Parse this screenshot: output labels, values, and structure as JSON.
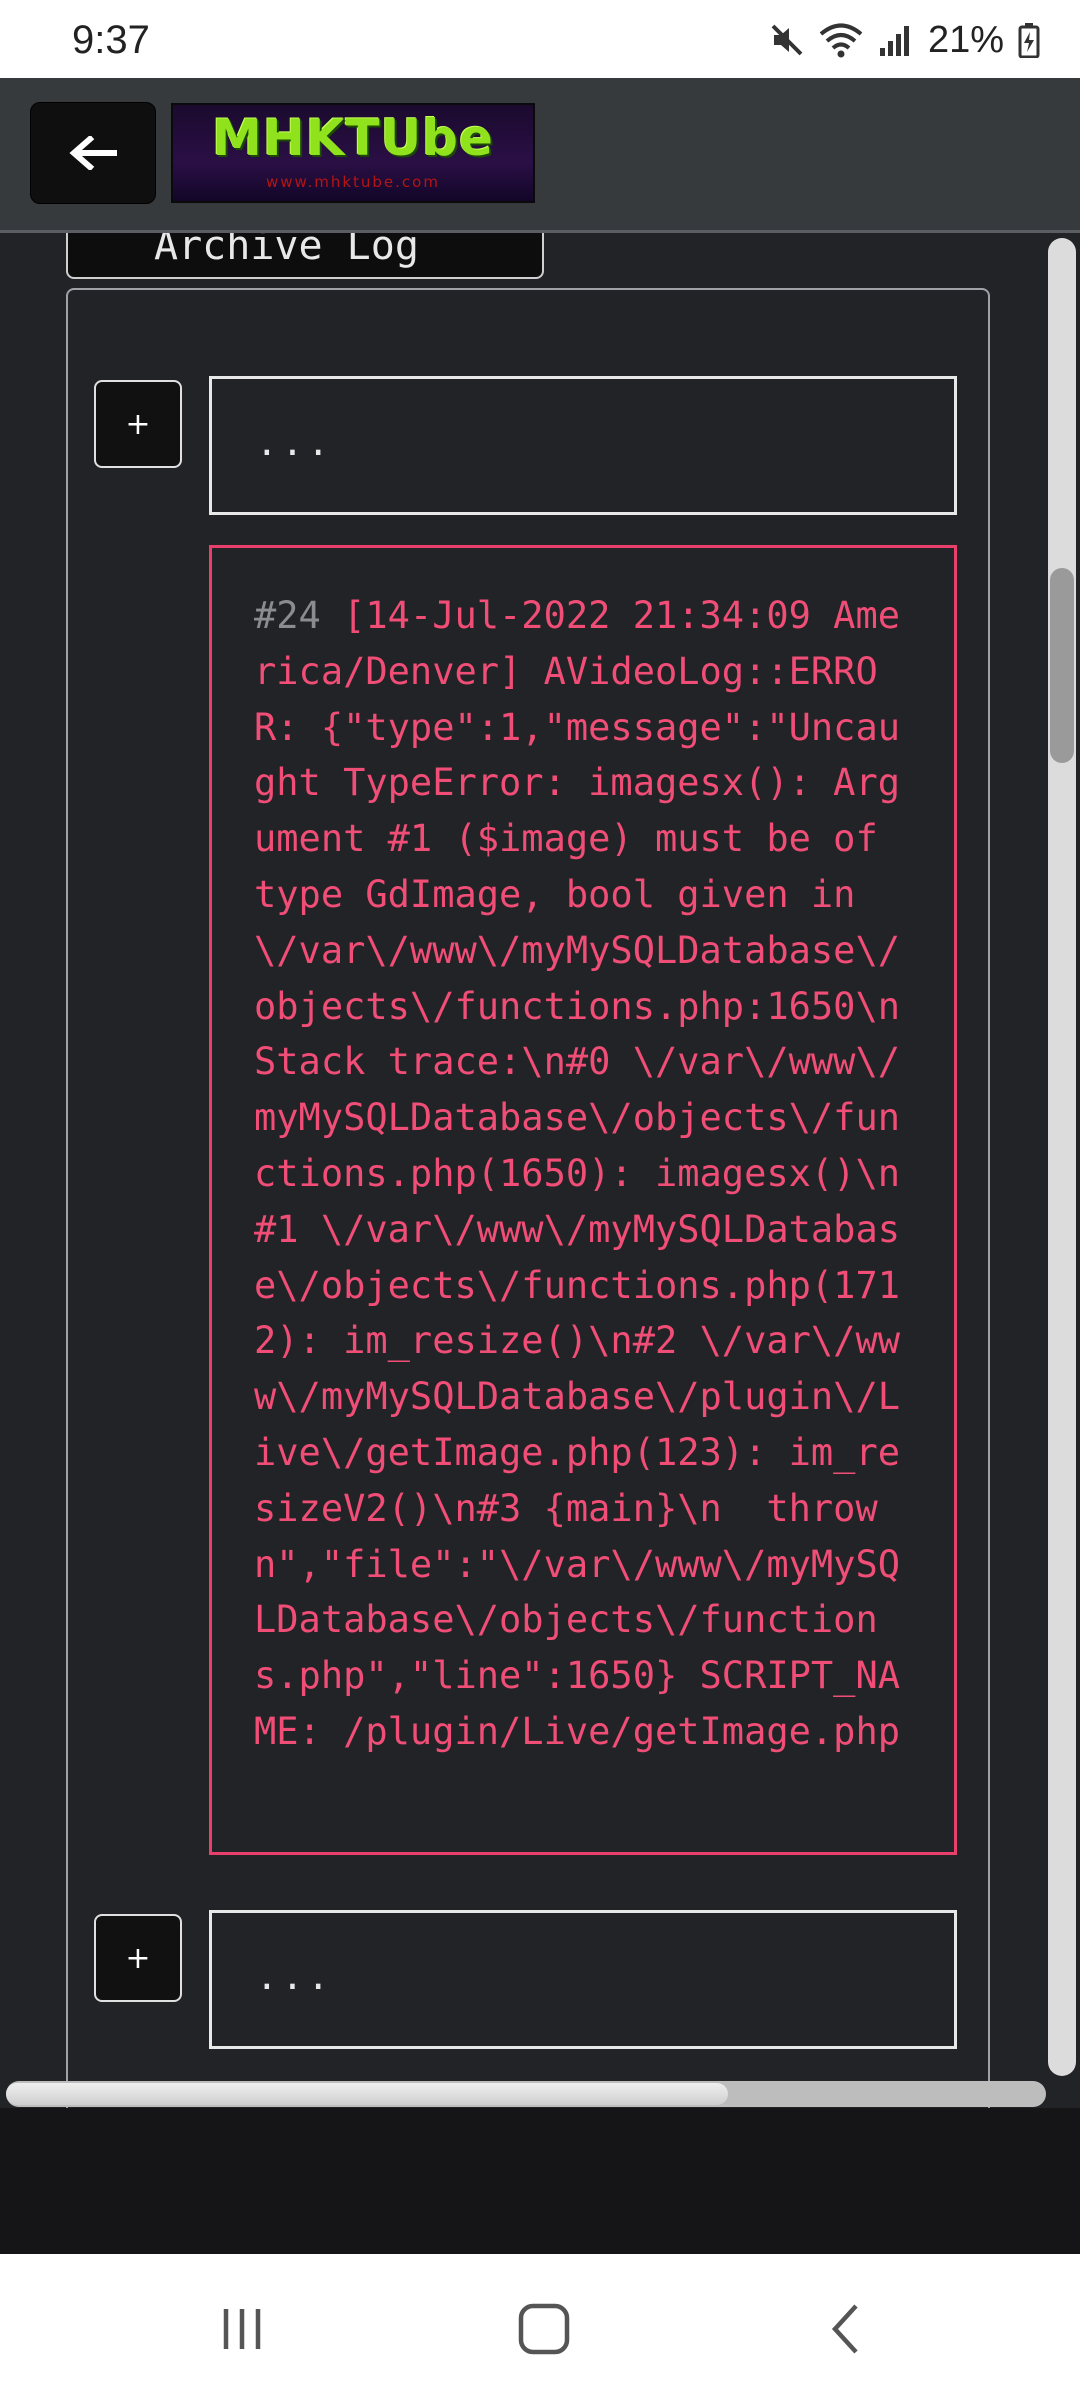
{
  "status_bar": {
    "time": "9:37",
    "battery_percent": "21%",
    "icons": [
      "mute-icon",
      "wifi-icon",
      "signal-icon",
      "battery-charging-icon"
    ]
  },
  "header": {
    "back_icon": "arrow-left-icon",
    "logo_text": "MHKTUbe",
    "logo_subtext": "www.mhktube.com"
  },
  "log_panel": {
    "tab_label": "Archive Log",
    "expand_label": "+",
    "collapsed_text": "...",
    "entry": {
      "number": "#24",
      "text": " [14-Jul-2022 21:34:09 America/Denver] AVideoLog::ERROR: {\"type\":1,\"message\":\"Uncaught TypeError: imagesx(): Argument #1 ($image) must be of type GdImage, bool given in \\/var\\/www\\/myMySQLDatabase\\/objects\\/functions.php:1650\\nStack trace:\\n#0 \\/var\\/www\\/myMySQLDatabase\\/objects\\/functions.php(1650): imagesx()\\n#1 \\/var\\/www\\/myMySQLDatabase\\/objects\\/functions.php(1712): im_resize()\\n#2 \\/var\\/www\\/myMySQLDatabase\\/plugin\\/Live\\/getImage.php(123): im_resizeV2()\\n#3 {main}\\n  thrown\",\"file\":\"\\/var\\/www\\/myMySQLDatabase\\/objects\\/functions.php\",\"line\":1650} SCRIPT_NAME: /plugin/Live/getImage.php"
    }
  },
  "colors": {
    "error": "#f04d77",
    "content_bg": "#222326",
    "header_bg": "#363a3d"
  },
  "nav_bar": {
    "icons": [
      "recent-apps-icon",
      "home-icon",
      "back-icon"
    ]
  }
}
